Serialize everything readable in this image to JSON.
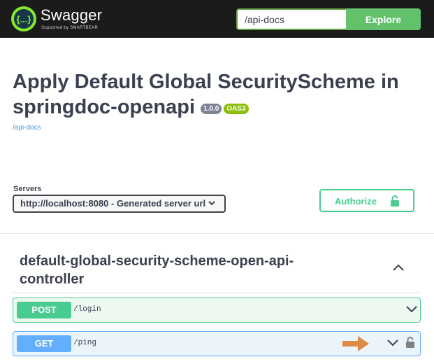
{
  "topbar": {
    "brand": "Swagger",
    "brand_sub": "Supported by SMARTBEAR",
    "url_value": "/api-docs",
    "explore_label": "Explore"
  },
  "info": {
    "title": "Apply Default Global SecurityScheme in springdoc-openapi",
    "version_badge": "1.0.0",
    "oas_badge": "OAS3",
    "doc_link": "/api-docs"
  },
  "scheme": {
    "servers_label": "Servers",
    "selected_server": "http://localhost:8080 - Generated server url",
    "authorize_label": "Authorize"
  },
  "tag": {
    "name": "default-global-security-scheme-open-api-controller"
  },
  "operations": [
    {
      "method": "POST",
      "path": "/login",
      "color": "#49cc90"
    },
    {
      "method": "GET",
      "path": "/ping",
      "color": "#61affe"
    }
  ],
  "colors": {
    "topbar": "#1b1b1b",
    "explore": "#62c26b",
    "authorize": "#49cc90",
    "arrow": "#dd8a43"
  },
  "icons": {
    "logo": "swagger-logo-icon",
    "chevron": "chevron-down-icon",
    "lock": "lock-icon",
    "arrow": "arrow-right-icon"
  }
}
